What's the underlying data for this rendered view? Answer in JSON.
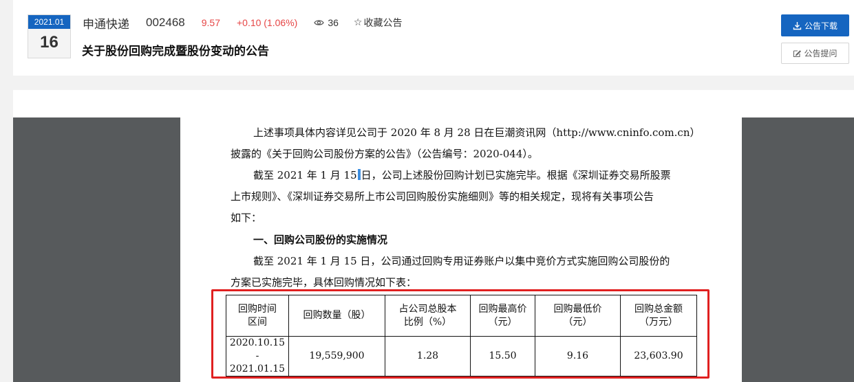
{
  "header": {
    "date_month": "2021.01",
    "date_day": "16",
    "company": "申通快递",
    "code": "002468",
    "price": "9.57",
    "change": "+0.10 (1.06%)",
    "views": "36",
    "favorite_label": "收藏公告",
    "title": "关于股份回购完成暨股份变动的公告",
    "download_label": "公告下载",
    "ask_label": "公告提问",
    "accent_color": "#1565c0",
    "change_color": "#e64545"
  },
  "document": {
    "para1_line1": "上述事项具体内容详见公司于 2020 年 8 月 28 日在巨潮资讯网（http://www.cninfo.com.cn）",
    "para1_line2": "披露的《关于回购公司股份方案的公告》（公告编号：2020-044）。",
    "para2_line1_a": "截至 2021 年 1 月 15",
    "para2_line1_b": "日，公司上述股份回购计划已实施完毕。根据《深圳证券交易所股票",
    "para2_line2": "上市规则》、《深圳证券交易所上市公司回购股份实施细则》等的相关规定，现将有关事项公告",
    "para2_line3": "如下：",
    "section_heading": "一、回购公司股份的实施情况",
    "para3_line1": "截至 2021 年 1 月 15 日，公司通过回购专用证券账户以集中竞价方式实施回购公司股份的",
    "para3_line2": "方案已实施完毕，具体回购情况如下表："
  },
  "table": {
    "headers": [
      [
        "回购时间",
        "区间"
      ],
      [
        "回购数量（股）"
      ],
      [
        "占公司总股本",
        "比例（%）"
      ],
      [
        "回购最高价",
        "（元）"
      ],
      [
        "回购最低价",
        "（元）"
      ],
      [
        "回购总金额",
        "（万元）"
      ]
    ],
    "row": {
      "period": [
        "2020.10.15",
        "-",
        "2021.01.15"
      ],
      "quantity": "19,559,900",
      "ratio": "1.28",
      "high": "15.50",
      "low": "9.16",
      "amount": "23,603.90"
    },
    "highlight_color": "#e02020"
  }
}
